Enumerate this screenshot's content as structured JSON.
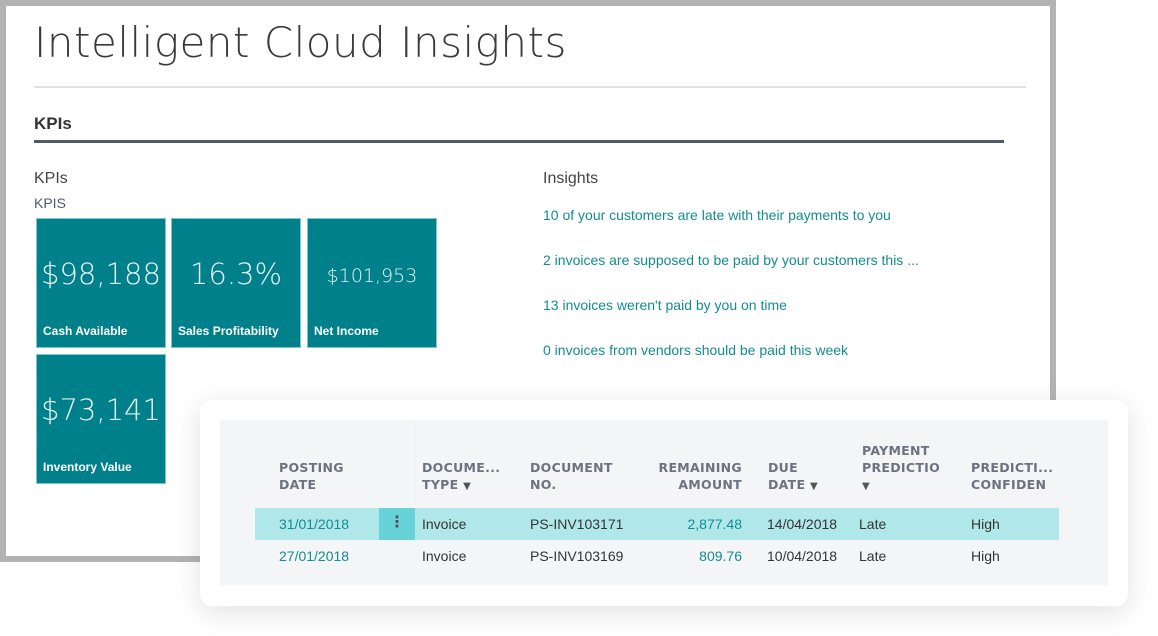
{
  "page": {
    "title": "Intelligent Cloud Insights",
    "section_title": "KPIs"
  },
  "kpis": {
    "caption": "KPIs",
    "link": "KPIS",
    "tiles": [
      {
        "value": "$98,188",
        "label": "Cash Available"
      },
      {
        "value": "16.3%",
        "label": "Sales Profitability"
      },
      {
        "value": "$101,953",
        "label": "Net Income"
      },
      {
        "value": "$73,141",
        "label": "Inventory Value"
      }
    ]
  },
  "insights": {
    "caption": "Insights",
    "items": [
      "10 of your customers are late with their payments to you",
      "2 invoices are supposed to be paid by your customers this ...",
      "13 invoices weren't paid by you on time",
      "0 invoices from vendors should be paid this week"
    ]
  },
  "table": {
    "columns": [
      {
        "line1": "POSTING",
        "line2": "DATE",
        "filter": false
      },
      {
        "line1": "DOCUME...",
        "line2": "TYPE",
        "filter": true
      },
      {
        "line1": "DOCUMENT",
        "line2": "NO.",
        "filter": false
      },
      {
        "line1": "REMAINING",
        "line2": "AMOUNT",
        "filter": false
      },
      {
        "line1": "DUE",
        "line2": "DATE",
        "filter": true
      },
      {
        "line1": "PAYMENT",
        "line2": "PREDICTIO",
        "filter": true
      },
      {
        "line1": "PREDICTI...",
        "line2": "CONFIDEN",
        "filter": false
      }
    ],
    "filter_icon": "▼",
    "row_menu_icon": "⋮",
    "rows": [
      {
        "posting_date": "31/01/2018",
        "document_type": "Invoice",
        "document_no": "PS-INV103171",
        "remaining_amount": "2,877.48",
        "due_date": "14/04/2018",
        "payment_prediction": "Late",
        "prediction_confidence": "High",
        "selected": true
      },
      {
        "posting_date": "27/01/2018",
        "document_type": "Invoice",
        "document_no": "PS-INV103169",
        "remaining_amount": "809.76",
        "due_date": "10/04/2018",
        "payment_prediction": "Late",
        "prediction_confidence": "High",
        "selected": false
      }
    ]
  },
  "colors": {
    "tile": "#00808b",
    "link": "#138c91",
    "selected_row": "#b0e8ea",
    "row_menu": "#66d3d9"
  }
}
